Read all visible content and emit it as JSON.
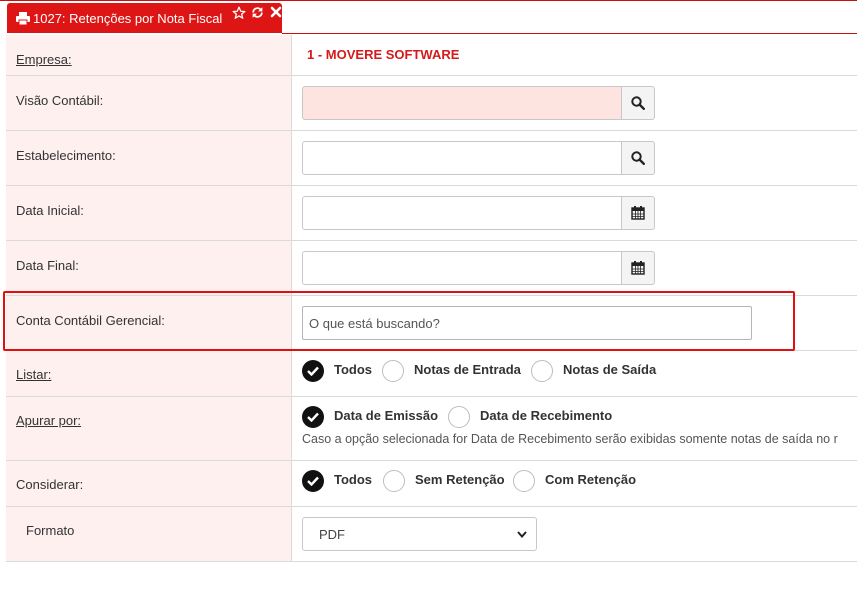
{
  "tab": {
    "title": "1027: Retenções por Nota Fiscal",
    "icons": [
      "print-icon",
      "star-icon",
      "refresh-icon",
      "close-icon"
    ]
  },
  "form": {
    "empresa": {
      "label": "Empresa:",
      "value": "1 - MOVERE SOFTWARE"
    },
    "visao_contabil": {
      "label": "Visão Contábil:",
      "value": ""
    },
    "estabelecimento": {
      "label": "Estabelecimento:",
      "value": ""
    },
    "data_inicial": {
      "label": "Data Inicial:",
      "value": ""
    },
    "data_final": {
      "label": "Data Final:",
      "value": ""
    },
    "conta_contabil_gerencial": {
      "label": "Conta Contábil Gerencial:",
      "placeholder": "O que está buscando?"
    },
    "listar": {
      "label": "Listar:",
      "options": [
        "Todos",
        "Notas de Entrada",
        "Notas de Saída"
      ],
      "selected": "Todos"
    },
    "apurar_por": {
      "label": "Apurar por:",
      "options": [
        "Data de Emissão",
        "Data de Recebimento"
      ],
      "selected": "Data de Emissão",
      "hint": "Caso a opção selecionada for Data de Recebimento serão exibidas somente notas de saída no r"
    },
    "considerar": {
      "label": "Considerar:",
      "options": [
        "Todos",
        "Sem Retenção",
        "Com Retenção"
      ],
      "selected": "Todos"
    },
    "formato": {
      "label": "Formato",
      "value": "PDF"
    }
  },
  "colors": {
    "accent": "#dd1515",
    "label_bg": "#fdf0ef",
    "required_bg": "#fde4e1"
  }
}
